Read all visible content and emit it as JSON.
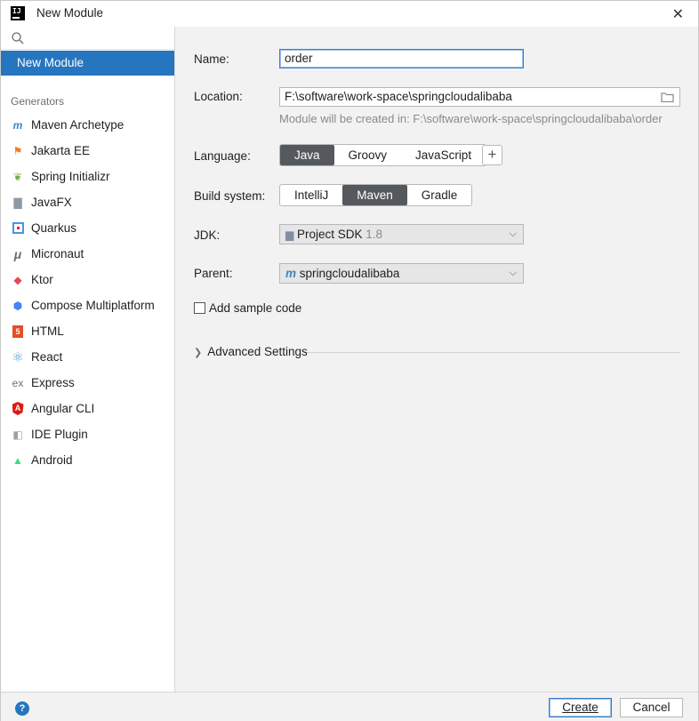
{
  "window": {
    "title": "New Module",
    "app_icon_text": "IJ"
  },
  "sidebar": {
    "selected_item": "New Module",
    "generators_title": "Generators",
    "generators": [
      {
        "label": "Maven Archetype",
        "icon": "maven-icon"
      },
      {
        "label": "Jakarta EE",
        "icon": "jakarta-icon"
      },
      {
        "label": "Spring Initializr",
        "icon": "spring-icon"
      },
      {
        "label": "JavaFX",
        "icon": "javafx-icon"
      },
      {
        "label": "Quarkus",
        "icon": "quarkus-icon"
      },
      {
        "label": "Micronaut",
        "icon": "micronaut-icon"
      },
      {
        "label": "Ktor",
        "icon": "ktor-icon"
      },
      {
        "label": "Compose Multiplatform",
        "icon": "compose-icon"
      },
      {
        "label": "HTML",
        "icon": "html5-icon"
      },
      {
        "label": "React",
        "icon": "react-icon"
      },
      {
        "label": "Express",
        "icon": "express-icon"
      },
      {
        "label": "Angular CLI",
        "icon": "angular-icon"
      },
      {
        "label": "IDE Plugin",
        "icon": "ide-plugin-icon"
      },
      {
        "label": "Android",
        "icon": "android-icon"
      }
    ]
  },
  "form": {
    "name_label": "Name:",
    "name_value": "order",
    "location_label": "Location:",
    "location_value": "F:\\software\\work-space\\springcloudalibaba",
    "location_hint": "Module will be created in: F:\\software\\work-space\\springcloudalibaba\\order",
    "language_label": "Language:",
    "languages": [
      "Java",
      "Groovy",
      "JavaScript"
    ],
    "language_selected": "Java",
    "add_language_label": "+",
    "build_label": "Build system:",
    "build_systems": [
      "IntelliJ",
      "Maven",
      "Gradle"
    ],
    "build_selected": "Maven",
    "jdk_label": "JDK:",
    "jdk_value": "Project SDK",
    "jdk_version": "1.8",
    "parent_label": "Parent:",
    "parent_value": "springcloudalibaba",
    "sample_code_label": "Add sample code",
    "sample_code_checked": false,
    "advanced_label": "Advanced Settings"
  },
  "footer": {
    "help_label": "?",
    "create_label": "Create",
    "cancel_label": "Cancel"
  },
  "colors": {
    "accent": "#2675bf",
    "segment_active": "#55595d",
    "focus_border": "#3d7ec9"
  }
}
